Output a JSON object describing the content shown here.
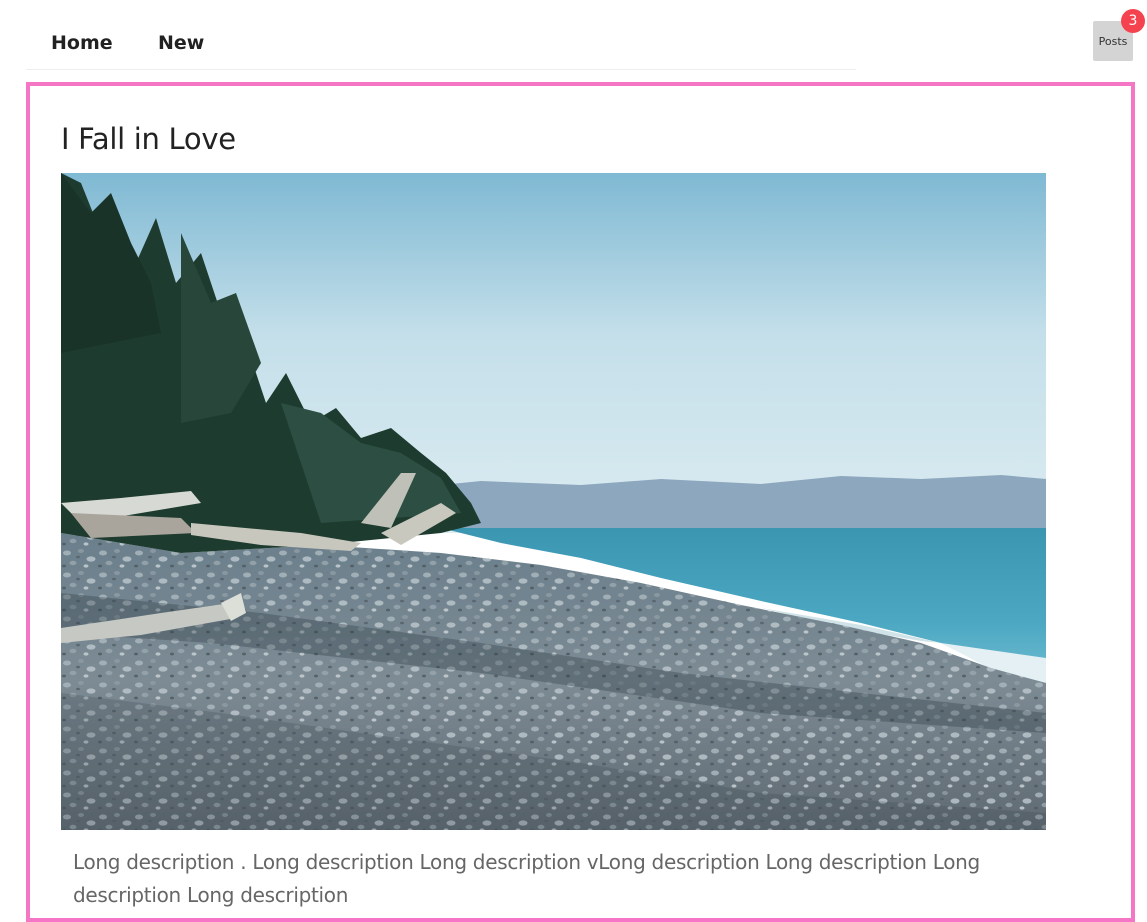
{
  "nav": {
    "items": [
      {
        "label": "Home"
      },
      {
        "label": "New"
      }
    ]
  },
  "posts_button": {
    "label": "Posts",
    "badge_count": "3"
  },
  "post": {
    "title": "I Fall in Love",
    "description": "Long description . Long description Long description vLong description Long description Long description Long description"
  },
  "colors": {
    "card_border": "#f576c4",
    "badge": "#f4434f",
    "posts_button_bg": "#d4d4d4"
  }
}
